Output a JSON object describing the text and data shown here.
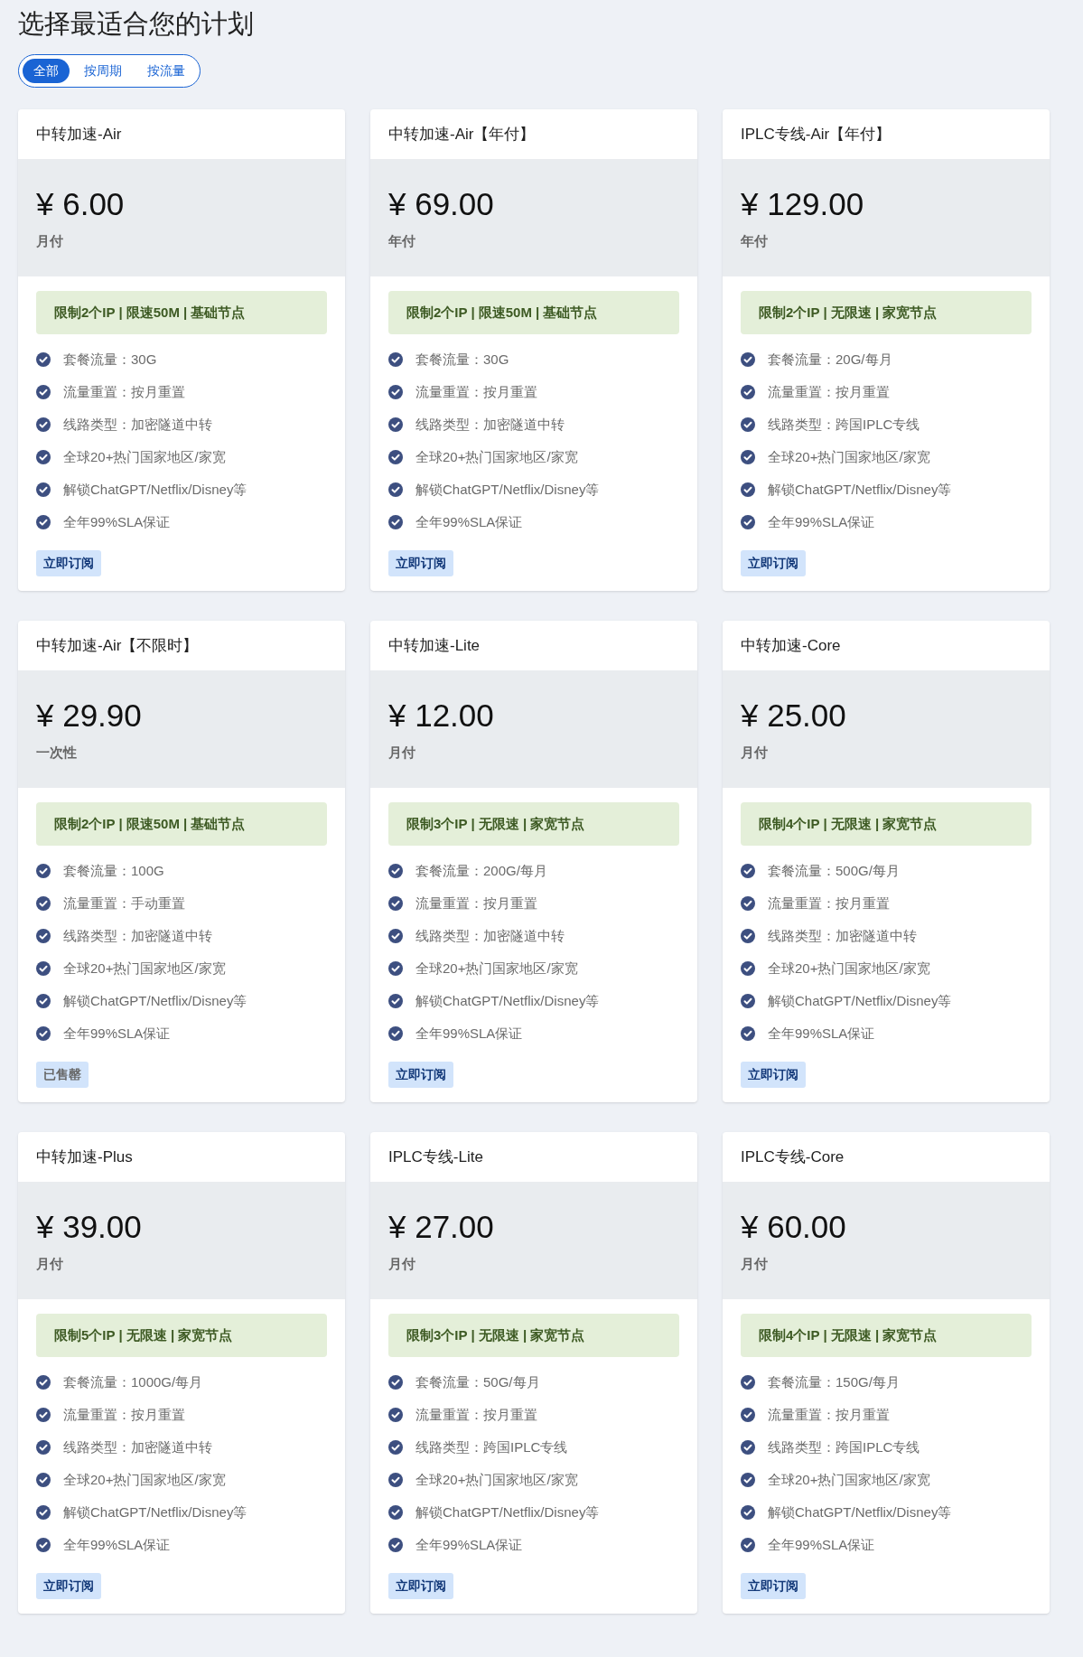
{
  "title": "选择最适合您的计划",
  "filters": [
    {
      "label": "全部",
      "selected": true
    },
    {
      "label": "按周期",
      "selected": false
    },
    {
      "label": "按流量",
      "selected": false
    }
  ],
  "plans": [
    {
      "name": "中转加速-Air",
      "price": "¥ 6.00",
      "period": "月付",
      "tag": "限制2个IP | 限速50M | 基础节点",
      "features": [
        "套餐流量：30G",
        "流量重置：按月重置",
        "线路类型：加密隧道中转",
        "全球20+热门国家地区/家宽",
        "解锁ChatGPT/Netflix/Disney等",
        "全年99%SLA保证"
      ],
      "button": {
        "label": "立即订阅",
        "disabled": false
      }
    },
    {
      "name": "中转加速-Air【年付】",
      "price": "¥ 69.00",
      "period": "年付",
      "tag": "限制2个IP | 限速50M | 基础节点",
      "features": [
        "套餐流量：30G",
        "流量重置：按月重置",
        "线路类型：加密隧道中转",
        "全球20+热门国家地区/家宽",
        "解锁ChatGPT/Netflix/Disney等",
        "全年99%SLA保证"
      ],
      "button": {
        "label": "立即订阅",
        "disabled": false
      }
    },
    {
      "name": "IPLC专线-Air【年付】",
      "price": "¥ 129.00",
      "period": "年付",
      "tag": "限制2个IP | 无限速 | 家宽节点",
      "features": [
        "套餐流量：20G/每月",
        "流量重置：按月重置",
        "线路类型：跨国IPLC专线",
        "全球20+热门国家地区/家宽",
        "解锁ChatGPT/Netflix/Disney等",
        "全年99%SLA保证"
      ],
      "button": {
        "label": "立即订阅",
        "disabled": false
      }
    },
    {
      "name": "中转加速-Air【不限时】",
      "price": "¥ 29.90",
      "period": "一次性",
      "tag": "限制2个IP | 限速50M | 基础节点",
      "features": [
        "套餐流量：100G",
        "流量重置：手动重置",
        "线路类型：加密隧道中转",
        "全球20+热门国家地区/家宽",
        "解锁ChatGPT/Netflix/Disney等",
        "全年99%SLA保证"
      ],
      "button": {
        "label": "已售罄",
        "disabled": true
      }
    },
    {
      "name": "中转加速-Lite",
      "price": "¥ 12.00",
      "period": "月付",
      "tag": "限制3个IP | 无限速 | 家宽节点",
      "features": [
        "套餐流量：200G/每月",
        "流量重置：按月重置",
        "线路类型：加密隧道中转",
        "全球20+热门国家地区/家宽",
        "解锁ChatGPT/Netflix/Disney等",
        "全年99%SLA保证"
      ],
      "button": {
        "label": "立即订阅",
        "disabled": false
      }
    },
    {
      "name": "中转加速-Core",
      "price": "¥ 25.00",
      "period": "月付",
      "tag": "限制4个IP | 无限速 | 家宽节点",
      "features": [
        "套餐流量：500G/每月",
        "流量重置：按月重置",
        "线路类型：加密隧道中转",
        "全球20+热门国家地区/家宽",
        "解锁ChatGPT/Netflix/Disney等",
        "全年99%SLA保证"
      ],
      "button": {
        "label": "立即订阅",
        "disabled": false
      }
    },
    {
      "name": "中转加速-Plus",
      "price": "¥ 39.00",
      "period": "月付",
      "tag": "限制5个IP | 无限速 | 家宽节点",
      "features": [
        "套餐流量：1000G/每月",
        "流量重置：按月重置",
        "线路类型：加密隧道中转",
        "全球20+热门国家地区/家宽",
        "解锁ChatGPT/Netflix/Disney等",
        "全年99%SLA保证"
      ],
      "button": {
        "label": "立即订阅",
        "disabled": false
      }
    },
    {
      "name": "IPLC专线-Lite",
      "price": "¥ 27.00",
      "period": "月付",
      "tag": "限制3个IP | 无限速 | 家宽节点",
      "features": [
        "套餐流量：50G/每月",
        "流量重置：按月重置",
        "线路类型：跨国IPLC专线",
        "全球20+热门国家地区/家宽",
        "解锁ChatGPT/Netflix/Disney等",
        "全年99%SLA保证"
      ],
      "button": {
        "label": "立即订阅",
        "disabled": false
      }
    },
    {
      "name": "IPLC专线-Core",
      "price": "¥ 60.00",
      "period": "月付",
      "tag": "限制4个IP | 无限速 | 家宽节点",
      "features": [
        "套餐流量：150G/每月",
        "流量重置：按月重置",
        "线路类型：跨国IPLC专线",
        "全球20+热门国家地区/家宽",
        "解锁ChatGPT/Netflix/Disney等",
        "全年99%SLA保证"
      ],
      "button": {
        "label": "立即订阅",
        "disabled": false
      }
    }
  ]
}
